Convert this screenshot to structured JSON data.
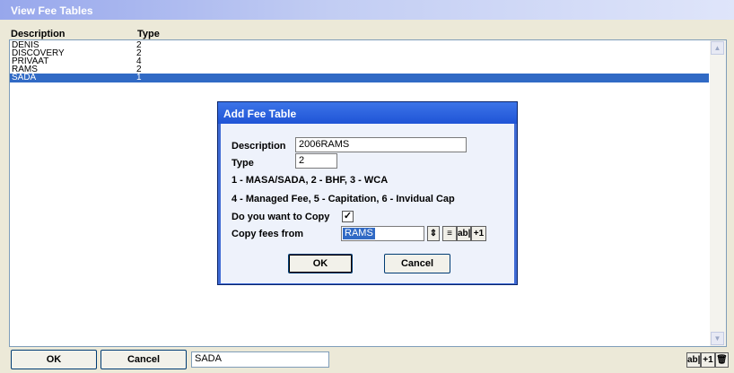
{
  "window": {
    "title": "View Fee Tables"
  },
  "list": {
    "columns": [
      "Description",
      "Type"
    ],
    "rows": [
      {
        "description": "DENIS",
        "type": "2"
      },
      {
        "description": "DISCOVERY",
        "type": "2"
      },
      {
        "description": "PRIVAAT",
        "type": "4"
      },
      {
        "description": "RAMS",
        "type": "2"
      },
      {
        "description": "SADA",
        "type": "1"
      }
    ],
    "selected_index": 4
  },
  "dialog": {
    "title": "Add Fee Table",
    "description_label": "Description",
    "description_value": "2006RAMS",
    "type_label": "Type",
    "type_value": "2",
    "legend_line1": "1 - MASA/SADA, 2 - BHF, 3 - WCA",
    "legend_line2": "4 - Managed Fee, 5 - Capitation, 6 - Invidual Cap",
    "copy_question": "Do you want to Copy",
    "copy_checked": "✓",
    "copy_from_label": "Copy fees from",
    "copy_from_value": "RAMS",
    "spin_glyph": "⇕",
    "list_glyph": "≡",
    "edit_glyph": "ab|",
    "plus_glyph": "+1",
    "ok_label": "OK",
    "cancel_label": "Cancel"
  },
  "footer": {
    "ok_label": "OK",
    "cancel_label": "Cancel",
    "search_value": "SADA",
    "edit_glyph": "ab|",
    "plus_glyph": "+1",
    "delete_glyph": "🗑"
  },
  "scroll": {
    "up_glyph": "▲",
    "down_glyph": "▼"
  }
}
